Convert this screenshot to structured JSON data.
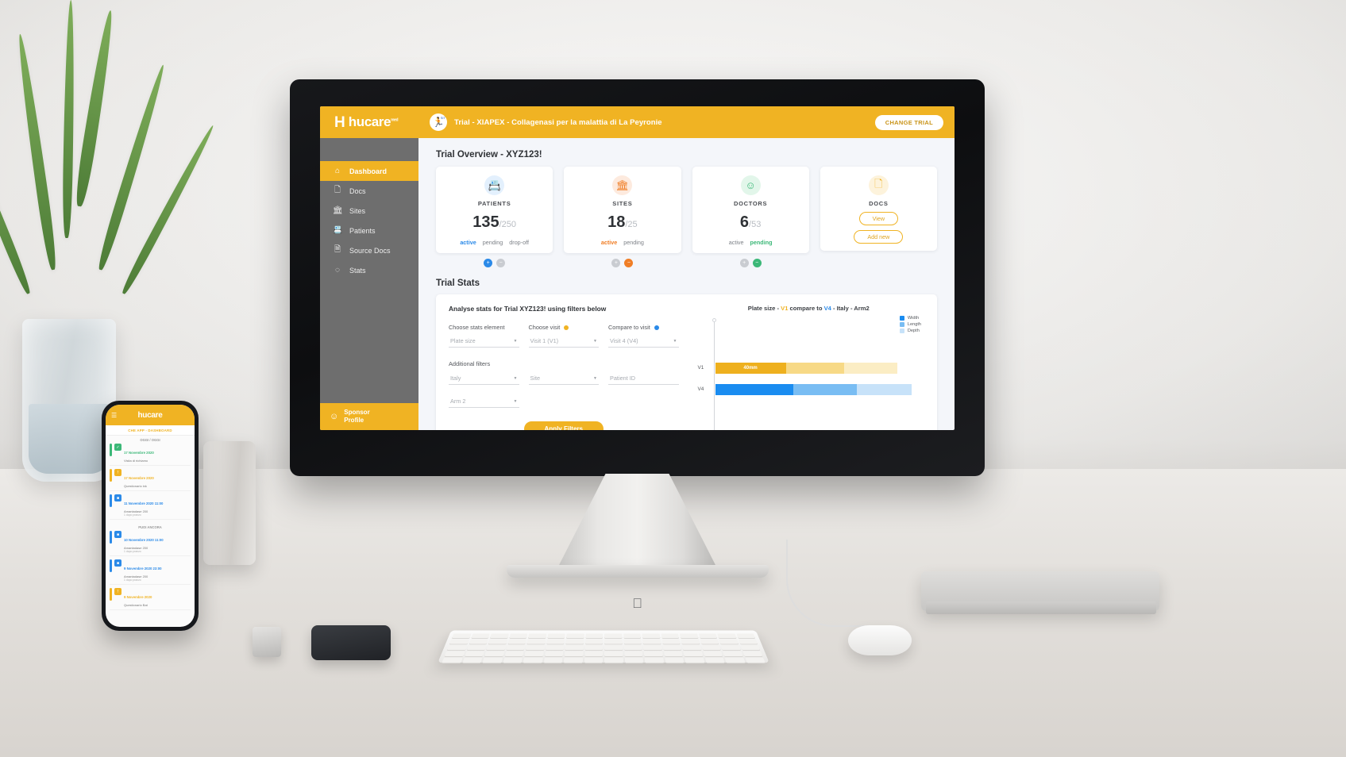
{
  "topbar": {
    "brand_hu": "hu",
    "brand_care": "care",
    "brand_tm": "med",
    "trial_text": "Trial - XIAPEX - Collagenasi per la malattia di La Peyronie",
    "avatar_icon": "person-running-icon",
    "avatar_sup": "SIT",
    "change_trial": "CHANGE TRIAL"
  },
  "sidebar": {
    "items": [
      {
        "label": "Dashboard",
        "icon": "home-icon",
        "active": true
      },
      {
        "label": "Docs",
        "icon": "document-icon",
        "active": false
      },
      {
        "label": "Sites",
        "icon": "bank-icon",
        "active": false
      },
      {
        "label": "Patients",
        "icon": "id-card-icon",
        "active": false
      },
      {
        "label": "Source Docs",
        "icon": "source-doc-icon",
        "active": false
      },
      {
        "label": "Stats",
        "icon": "circle-chart-icon",
        "active": false
      }
    ],
    "sponsor_line1": "Sponsor",
    "sponsor_line2": "Profile",
    "sponsor_icon": "user-circle-icon"
  },
  "overview": {
    "title": "Trial Overview - XYZ123!",
    "cards": [
      {
        "label": "PATIENTS",
        "icon": "id-card-icon",
        "icon_color": "#2b8ae8",
        "icon_bg": "#e3f0fd",
        "value": "135",
        "denominator": "/250",
        "tabs": [
          {
            "text": "active",
            "selected": true,
            "color": "#2b8ae8"
          },
          {
            "text": "pending",
            "selected": false,
            "color": "#7d8187"
          },
          {
            "text": "drop-off",
            "selected": false,
            "color": "#7d8187"
          }
        ],
        "mini_buttons": [
          {
            "icon": "plus-icon",
            "color": "#2b8ae8"
          },
          {
            "icon": "minus-icon",
            "color": "#c9ccd1"
          }
        ]
      },
      {
        "label": "SITES",
        "icon": "bank-icon",
        "icon_color": "#f07e26",
        "icon_bg": "#fdeade",
        "value": "18",
        "denominator": "/25",
        "tabs": [
          {
            "text": "active",
            "selected": true,
            "color": "#f07e26"
          },
          {
            "text": "pending",
            "selected": false,
            "color": "#7d8187"
          }
        ],
        "mini_buttons": [
          {
            "icon": "plus-icon",
            "color": "#c9ccd1"
          },
          {
            "icon": "minus-icon",
            "color": "#f07e26"
          }
        ]
      },
      {
        "label": "DOCTORS",
        "icon": "doctor-face-icon",
        "icon_color": "#3cb878",
        "icon_bg": "#e2f6ea",
        "value": "6",
        "denominator": "/53",
        "tabs": [
          {
            "text": "active",
            "selected": false,
            "color": "#7d8187"
          },
          {
            "text": "pending",
            "selected": true,
            "color": "#3cb878"
          }
        ],
        "mini_buttons": [
          {
            "icon": "plus-icon",
            "color": "#c9ccd1"
          },
          {
            "icon": "minus-icon",
            "color": "#3cb878"
          }
        ]
      },
      {
        "label": "DOCS",
        "icon": "document-icon",
        "icon_color": "#f0b323",
        "icon_bg": "#fdf3dc",
        "buttons": [
          "View",
          "Add new"
        ]
      }
    ]
  },
  "stats": {
    "heading": "Trial Stats",
    "intro_pre": "Analyse stats for Trial ",
    "intro_bold": "XYZ123!",
    "intro_post": " using filters below",
    "filters": [
      {
        "label": "Choose stats element",
        "value": "Plate size",
        "dot": null
      },
      {
        "label": "Choose visit",
        "value": "Visit 1  (V1)",
        "dot": "#f0b323"
      },
      {
        "label": "Compare to visit",
        "value": "Visit 4  (V4)",
        "dot": "#2b8ae8"
      }
    ],
    "additional_label": "Additional filters",
    "additional": [
      {
        "value": "Italy"
      },
      {
        "value": "Site"
      },
      {
        "value": "Patient ID"
      }
    ],
    "arm": {
      "value": "Arm 2"
    },
    "apply_label": "Apply Filters"
  },
  "chart_data": {
    "type": "bar",
    "orientation": "horizontal",
    "stacked": true,
    "title_parts": {
      "pre": "Plate size - ",
      "v1": "V1",
      "mid": " compare to ",
      "v4": "V4",
      "post": " - Italy - Arm2"
    },
    "title": "Plate size - V1 compare to V4 - Italy - Arm2",
    "categories": [
      "V1",
      "V4"
    ],
    "legend": [
      {
        "name": "Width",
        "color": "#1a8cf0"
      },
      {
        "name": "Length",
        "color": "#79bdf3"
      },
      {
        "name": "Depth",
        "color": "#c7e2f9"
      }
    ],
    "series": [
      {
        "name": "Width",
        "values": [
          40,
          44
        ],
        "unit": "mm",
        "colors": {
          "V1": "#eeb01e",
          "V4": "#1a8cf0"
        },
        "labels": {
          "V1": "40mm",
          "V4": ""
        }
      },
      {
        "name": "Length",
        "values": [
          33,
          36
        ],
        "unit": "mm",
        "colors": {
          "V1": "#f7d986",
          "V4": "#79bdf3"
        },
        "labels": {
          "V1": "",
          "V4": ""
        }
      },
      {
        "name": "Depth",
        "values": [
          30,
          31
        ],
        "unit": "mm",
        "colors": {
          "V1": "#fbedc4",
          "V4": "#c7e2f9"
        },
        "labels": {
          "V1": "",
          "V4": ""
        }
      }
    ],
    "grid": false,
    "legend_position": "top-right"
  },
  "phone": {
    "brand": "hucare",
    "menu_icon": "hamburger-icon",
    "subbar": "CHE APP - DASHBOARD",
    "day_label_1": "OGGI / OGGI",
    "day_label_2": "PUOI ANCORA",
    "items": [
      {
        "t1": "17 Novembre 2020",
        "t2": "Visita di richiamo",
        "accent": "#3cb878",
        "ico": "#3cb878",
        "ico_glyph": "✓"
      },
      {
        "t1": "17 Novembre 2020",
        "t2": "Questionario ink",
        "accent": "#f0b323",
        "ico": "#f0b323",
        "ico_glyph": "!"
      },
      {
        "t1": "11 Novembre 2020 11:00",
        "t2": "Amantadase 200",
        "t3": "1 dopo pranzo",
        "accent": "#2b8ae8",
        "ico": "#2b8ae8",
        "ico_glyph": "■"
      },
      {
        "t1": "10 Novembre 2020 11:00",
        "t2": "Amantadase 200",
        "t3": "1 dopo pranzo",
        "accent": "#2b8ae8",
        "ico": "#2b8ae8",
        "ico_glyph": "■"
      },
      {
        "t1": "9 Novembre 2020 23:00",
        "t2": "Amantadase 200",
        "t3": "1 dopo pranzo",
        "accent": "#2b8ae8",
        "ico": "#2b8ae8",
        "ico_glyph": "■"
      },
      {
        "t1": "9 Novembre 2020",
        "t2": "Questionario Bat",
        "accent": "#f0b323",
        "ico": "#f0b323",
        "ico_glyph": "!"
      }
    ]
  },
  "desktop": {
    "apple_logo": ""
  }
}
